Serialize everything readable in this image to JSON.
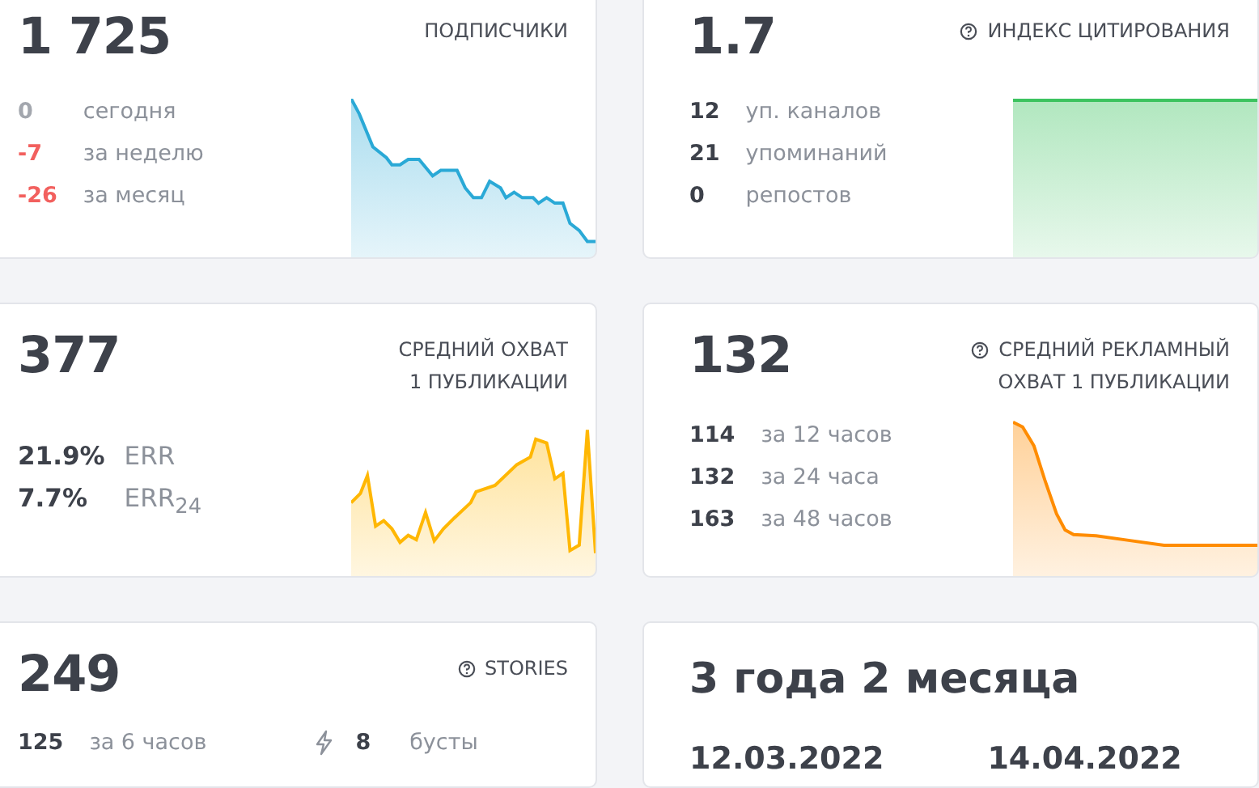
{
  "cards": [
    {
      "kind": "stats",
      "value": "1 725",
      "title": [
        "ПОДПИСЧИКИ"
      ],
      "help_icon": false,
      "rows": [
        {
          "value": "0",
          "label": "сегодня",
          "color": "#a3a7ae"
        },
        {
          "value": "-7",
          "label": "за неделю",
          "color": "#f2605e"
        },
        {
          "value": "-26",
          "label": "за месяц",
          "color": "#f2605e"
        }
      ],
      "chart": {
        "kind": "decline",
        "color": "#2aa9d6"
      }
    },
    {
      "kind": "stats",
      "value": "1.7",
      "title": [
        "ИНДЕКС ЦИТИРОВАНИЯ"
      ],
      "help_icon": true,
      "rows": [
        {
          "value": "12",
          "label": "уп. каналов"
        },
        {
          "value": "21",
          "label": "упоминаний"
        },
        {
          "value": "0",
          "label": "репостов"
        }
      ],
      "chart": {
        "kind": "flat",
        "color": "#3cc35f"
      }
    },
    {
      "kind": "err",
      "value": "377",
      "title": [
        "СРЕДНИЙ ОХВАТ",
        "1 ПУБЛИКАЦИИ"
      ],
      "help_icon": false,
      "rows": [
        {
          "value": "21.9%",
          "label": "ERR"
        },
        {
          "value": "7.7%",
          "label": "ERR$_{24}$"
        }
      ],
      "chart": {
        "kind": "wave",
        "color": "#ffb703"
      }
    },
    {
      "kind": "stats",
      "value": "132",
      "title": [
        "СРЕДНИЙ РЕКЛАМНЫЙ",
        "ОХВАТ 1 ПУБЛИКАЦИИ"
      ],
      "help_icon": true,
      "rows": [
        {
          "value": "114",
          "label": "за 12 часов"
        },
        {
          "value": "132",
          "label": "за 24 часа"
        },
        {
          "value": "163",
          "label": "за 48 часов"
        }
      ],
      "chart": {
        "kind": "drop",
        "color": "#ff8c00"
      }
    },
    {
      "kind": "inline",
      "value": "249",
      "title": [
        "STORIES"
      ],
      "help_icon": true,
      "rows": [
        {
          "kind": "plain",
          "value": "125",
          "label": "за 6 часов"
        },
        {
          "kind": "boost",
          "value": "8",
          "label": "бусты"
        }
      ]
    },
    {
      "kind": "dates",
      "value": "3 года 2 месяца",
      "dates": [
        "12.03.2022",
        "14.04.2022"
      ]
    }
  ]
}
